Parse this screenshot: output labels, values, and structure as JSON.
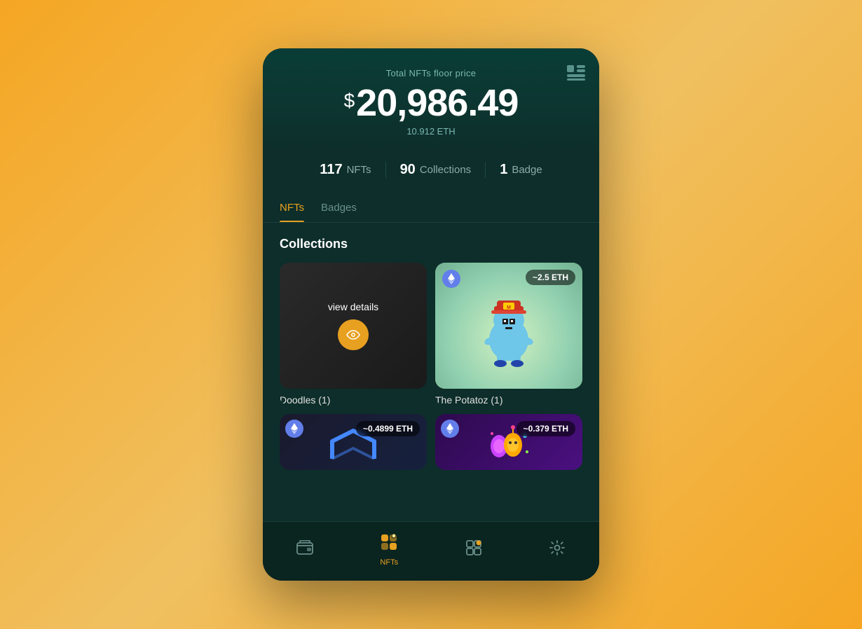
{
  "header": {
    "floor_label": "Total NFTs floor price",
    "dollar_sign": "$",
    "main_price": "20,986.49",
    "eth_price": "10.912 ETH",
    "layout_icon": "⊞"
  },
  "stats": {
    "nfts_count": "117",
    "nfts_label": "NFTs",
    "collections_count": "90",
    "collections_label": "Collections",
    "badge_count": "1",
    "badge_label": "Badge"
  },
  "tabs": [
    {
      "id": "nfts",
      "label": "NFTs",
      "active": true
    },
    {
      "id": "badges",
      "label": "Badges",
      "active": false
    }
  ],
  "collections_title": "Collections",
  "collection_cards": [
    {
      "id": "doodles",
      "name": "Doodles (1)",
      "overlay": true,
      "view_details_text": "view details",
      "type": "doodles"
    },
    {
      "id": "potatoz",
      "name": "The Potatoz (1)",
      "eth_value": "~2.5 ETH",
      "type": "potatoz"
    }
  ],
  "bottom_cards": [
    {
      "id": "maverick",
      "eth_value": "~0.4899 ETH",
      "type": "maverick"
    },
    {
      "id": "cosmic",
      "eth_value": "~0.379 ETH",
      "type": "cosmic"
    }
  ],
  "nav": {
    "items": [
      {
        "id": "wallet",
        "label": "",
        "active": false,
        "icon": "wallet"
      },
      {
        "id": "nfts",
        "label": "NFTs",
        "active": true,
        "icon": "nfts"
      },
      {
        "id": "apps",
        "label": "",
        "active": false,
        "icon": "apps"
      },
      {
        "id": "settings",
        "label": "",
        "active": false,
        "icon": "settings"
      }
    ]
  }
}
